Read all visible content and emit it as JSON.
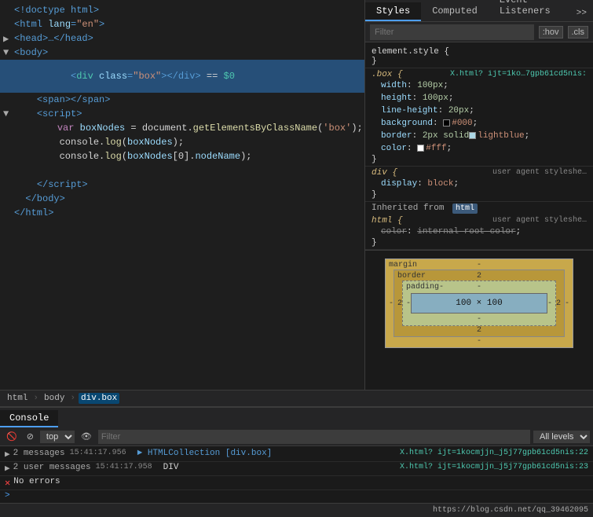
{
  "tabs": {
    "styles_label": "Styles",
    "computed_label": "Computed",
    "event_listeners_label": "Event Listeners",
    "more_label": ">>"
  },
  "filter": {
    "placeholder": "Filter",
    "hov_label": ":hov",
    "cls_label": ".cls"
  },
  "styles": {
    "element_style_selector": "element.style {",
    "element_style_close": "}",
    "box_rule_selector": ".box {",
    "box_rule_source": "X.html? ijt=1ko…7gpb61cd5nis:",
    "box_props": [
      {
        "name": "width",
        "val": "100px",
        "type": "num"
      },
      {
        "name": "height",
        "val": "100px",
        "type": "num"
      },
      {
        "name": "line-height",
        "val": "20px",
        "type": "num"
      },
      {
        "name": "background",
        "val": "#000",
        "type": "color",
        "swatch": "#000000"
      },
      {
        "name": "border",
        "val": "2px solid",
        "type": "mixed",
        "swatch2": "lightblue"
      },
      {
        "name": "color",
        "val": "#fff",
        "type": "color",
        "swatch": "#ffffff"
      }
    ],
    "div_selector": "div {",
    "div_ua": "user agent styleshe…",
    "div_props": [
      {
        "name": "display",
        "val": "block"
      }
    ],
    "inherited_label": "Inherited from",
    "inherited_tag": "html",
    "html_selector": "html {",
    "html_ua": "user agent styleshe…",
    "html_props": [
      {
        "name": "color",
        "val": "internal root color",
        "strikethrough": true
      }
    ]
  },
  "box_model": {
    "margin_label": "margin",
    "margin_dash": "-",
    "border_label": "border",
    "border_val": "2",
    "padding_label": "padding-",
    "padding_dash": "-",
    "content": "100 × 100",
    "left_val": "2",
    "right_val": "2",
    "bottom_val": "2",
    "bottom2_val": "-"
  },
  "breadcrumb": {
    "items": [
      {
        "label": "html",
        "active": false
      },
      {
        "label": "body",
        "active": false
      },
      {
        "label": "div.box",
        "active": true
      }
    ]
  },
  "console": {
    "tab_label": "Console",
    "toolbar": {
      "top_label": "top",
      "filter_placeholder": "Filter",
      "levels_label": "All levels"
    },
    "rows": [
      {
        "type": "expand",
        "count": "2 messages",
        "timestamp": "15:41:17.956",
        "text": "► HTMLCollection [div.box]",
        "link": "X.html? ijt=1kocmjjn_j5j77gpb61cd5nis:22"
      },
      {
        "type": "expand",
        "count": "2 user messages",
        "timestamp": "15:41:17.958",
        "text": "DIV",
        "link": "X.html? ijt=1kocmjjn_j5j77gpb61cd5nis:23"
      },
      {
        "type": "error",
        "text": "No errors"
      }
    ],
    "status_url": "https://blog.csdn.net/qq_39462095"
  },
  "code": {
    "lines": [
      {
        "indent": 0,
        "html": "&lt;!doctype html&gt;",
        "type": "doctype"
      },
      {
        "indent": 0,
        "html": "&lt;html lang=\"en\"&gt;",
        "type": "tag"
      },
      {
        "indent": 1,
        "html": "&lt;head&gt;…&lt;/head&gt;",
        "type": "collapsed"
      },
      {
        "indent": 1,
        "arrow": "▼",
        "html": "&lt;body&gt;",
        "type": "open"
      },
      {
        "indent": 2,
        "html": "div class=\"box\"&gt;&lt;/div&gt; == $0",
        "type": "selected"
      },
      {
        "indent": 3,
        "html": "&lt;span&gt;&lt;/span&gt;",
        "type": "tag"
      },
      {
        "indent": 3,
        "arrow": "▼",
        "html": "&lt;script&gt;",
        "type": "open"
      },
      {
        "indent": 4,
        "html": "var boxNodes = document.getElementsByClassName('box');",
        "type": "js"
      },
      {
        "indent": 4,
        "html": "console.log(boxNodes);",
        "type": "js"
      },
      {
        "indent": 4,
        "html": "console.log(boxNodes[0].nodeName);",
        "type": "js"
      },
      {
        "indent": 3,
        "html": "&lt;/script&gt;",
        "type": "tag"
      },
      {
        "indent": 2,
        "html": "&lt;/body&gt;",
        "type": "tag"
      },
      {
        "indent": 1,
        "html": "&lt;/html&gt;",
        "type": "tag"
      }
    ]
  }
}
